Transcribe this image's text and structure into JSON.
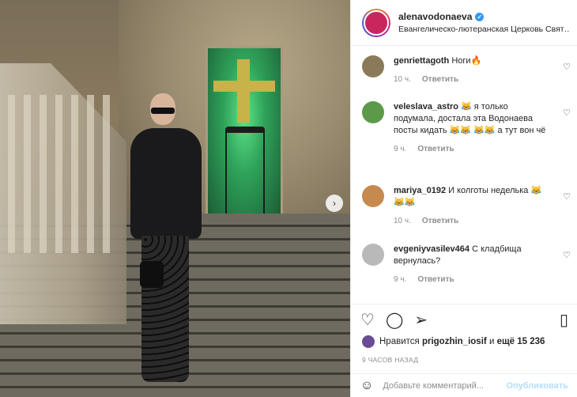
{
  "post": {
    "author": "alenavodonaeva",
    "location": "Евангелическо-лютеранская Церковь Свято...",
    "verified_icon": "verified-check-icon"
  },
  "photo": {
    "next_icon": "chevron-right-icon"
  },
  "comments": [
    {
      "user": "genriettagoth",
      "text": "Ноги🔥",
      "time": "10 ч.",
      "reply": "Ответить",
      "avatar_color": "#8b7a5a"
    },
    {
      "user": "veleslava_astro",
      "text": "😹 я только подумала, достала эта Водонаева посты кидать 😹😹 😹😹 а тут вон чё",
      "time": "9 ч.",
      "reply": "Ответить",
      "avatar_color": "#5c9a4a"
    },
    {
      "user": "mariya_0192",
      "text": "И колготы неделька 😹😹😹",
      "time": "10 ч.",
      "reply": "Ответить",
      "avatar_color": "#c68a4e"
    },
    {
      "user": "evgeniyvasilev464",
      "text": "С кладбища вернулась?",
      "time": "9 ч.",
      "reply": "Ответить",
      "avatar_color": "#b9b9b9"
    }
  ],
  "likes": {
    "prefix": "Нравится",
    "user": "prigozhin_iosif",
    "middle": "и",
    "rest": "ещё 15 236"
  },
  "time_ago": "9 ЧАСОВ НАЗАД",
  "add_comment": {
    "placeholder": "Добавьте комментарий...",
    "post_label": "Опубликовать"
  }
}
